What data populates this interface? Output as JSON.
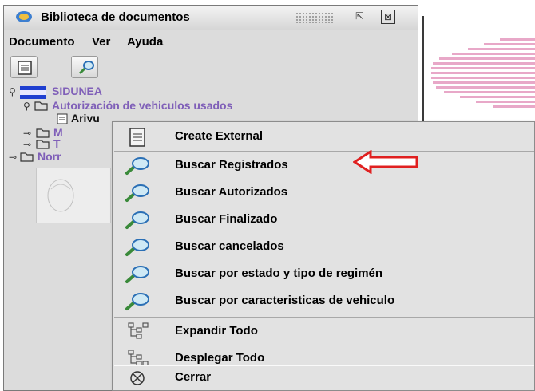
{
  "window": {
    "title": "Biblioteca de documentos",
    "float_symbol": "⇱",
    "maximize_symbol": "⊠"
  },
  "menubar": {
    "items": [
      "Documento",
      "Ver",
      "Ayuda"
    ]
  },
  "toolbar": {
    "buttons": [
      "document-icon",
      "search-icon"
    ]
  },
  "tree": {
    "root": "SIDUNEA",
    "folder": "Autorización de vehiculos usados",
    "selected_doc": "Arivu",
    "partial_1": "M",
    "partial_2": "T",
    "partial_3": "Norr"
  },
  "context_menu": {
    "items": [
      {
        "label": "Create External",
        "icon": "document-icon"
      },
      {
        "label": "Buscar Registrados",
        "icon": "search-icon"
      },
      {
        "label": "Buscar Autorizados",
        "icon": "search-icon"
      },
      {
        "label": "Buscar Finalizado",
        "icon": "search-icon"
      },
      {
        "label": "Buscar cancelados",
        "icon": "search-icon"
      },
      {
        "label": "Buscar por estado y tipo de regimén",
        "icon": "search-icon"
      },
      {
        "label": "Buscar por caracteristicas de vehiculo",
        "icon": "search-icon"
      },
      {
        "label": "Expandir Todo",
        "icon": "expand-tree-icon"
      },
      {
        "label": "Desplegar Todo",
        "icon": "collapse-tree-icon"
      },
      {
        "label": "Cerrar",
        "icon": "close-circle-icon"
      }
    ]
  },
  "annotation": {
    "arrow_color": "#e02020",
    "points_to": "Buscar Registrados"
  },
  "colors": {
    "tree_label": "#7f5fb8",
    "sidunea_flag": "#1f3fd0"
  }
}
